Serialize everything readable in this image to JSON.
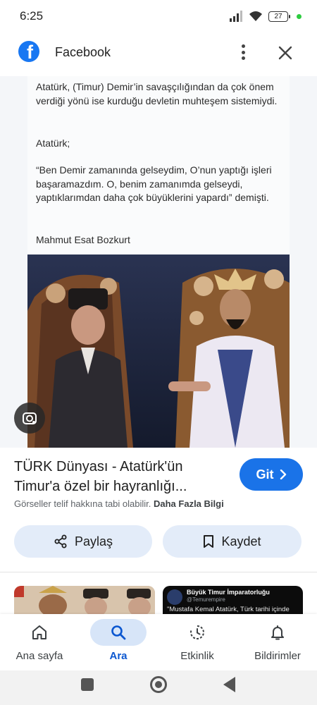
{
  "status_bar": {
    "time": "6:25",
    "battery": "27"
  },
  "header": {
    "title": "Facebook",
    "logo_letter": "f",
    "brand_color": "#1877f2",
    "menu_icon": "more-vert-icon",
    "close_icon": "close-icon"
  },
  "post": {
    "paragraph_1": "Atatürk, (Timur) Demir’in savaşçılığından da çok önem verdiği yönü ise kurduğu devletin muhteşem sistemiydi.",
    "paragraph_2": "Atatürk;",
    "paragraph_3": "“Ben Demir zamanında gelseydim, O’nun yaptığı işleri başaramazdım. O, benim zamanımda gelseydi, yaptıklarımdan daha çok büyüklerini yapardı” demişti.",
    "author": "Mahmut Esat Bozkurt"
  },
  "result": {
    "title": "TÜRK Dünyası - Atatürk'ün Timur'a özel bir hayranlığı...",
    "visit_label": "Git",
    "copyright_text": "Görseller telif hakkına tabi olabilir.",
    "more_info_label": "Daha Fazla Bilgi",
    "accent_color": "#1a73e8"
  },
  "actions": {
    "share_label": "Paylaş",
    "save_label": "Kaydet"
  },
  "related": {
    "tweet_name": "Büyük Timur İmparatorluğu",
    "tweet_handle": "@Temurempire",
    "tweet_text": "\"Mustafa Kemal Atatürk, Türk tarihi içinde"
  },
  "bottom_nav": {
    "items": [
      {
        "label": "Ana sayfa",
        "icon": "home-icon",
        "active": false
      },
      {
        "label": "Ara",
        "icon": "search-icon",
        "active": true
      },
      {
        "label": "Etkinlik",
        "icon": "activity-icon",
        "active": false
      },
      {
        "label": "Bildirimler",
        "icon": "bell-icon",
        "active": false
      }
    ]
  }
}
